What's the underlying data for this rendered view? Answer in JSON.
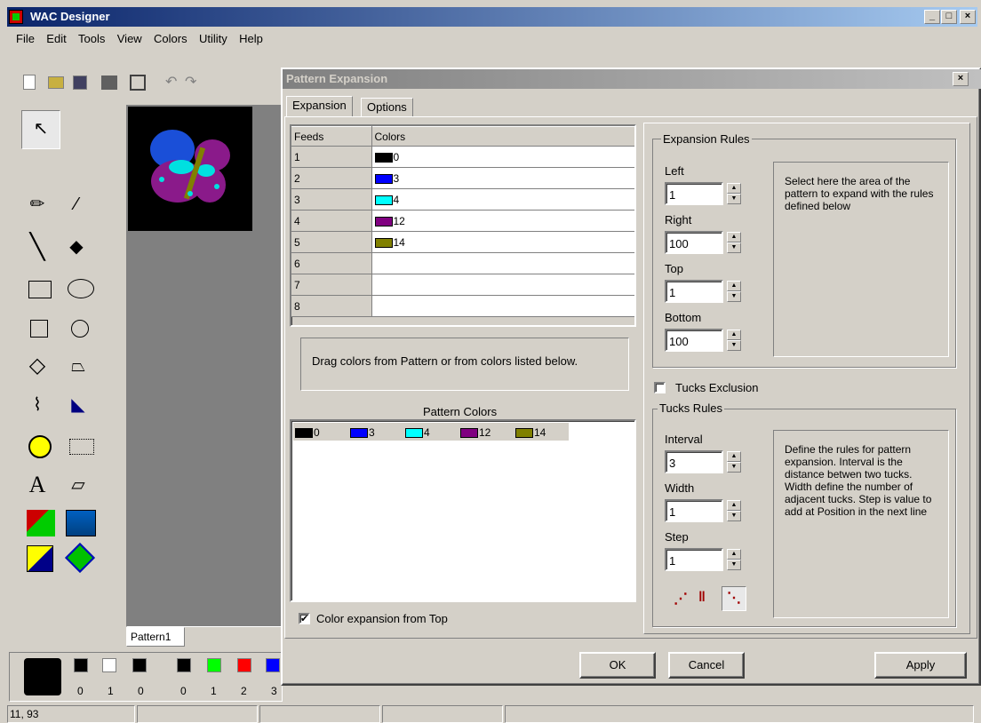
{
  "app": {
    "title": "WAC Designer",
    "btn_min": "_",
    "btn_max": "□",
    "btn_close": "×"
  },
  "menu": [
    "File",
    "Edit",
    "Tools",
    "View",
    "Colors",
    "Utility",
    "Help"
  ],
  "document_tab": "Pattern1",
  "palette_bg": {
    "labels": [
      "0",
      "1",
      "0"
    ],
    "colors": [
      "#000000",
      "#ffffff",
      "#000000"
    ]
  },
  "palette_main": {
    "labels": [
      "0",
      "1",
      "2",
      "3"
    ],
    "colors": [
      "#000000",
      "#00ff00",
      "#ff0000",
      "#0000ff"
    ]
  },
  "status": {
    "coords": "11, 93"
  },
  "dialog": {
    "title": "Pattern Expansion",
    "close": "×",
    "tabs": [
      "Expansion",
      "Options"
    ],
    "feeds_header": "Feeds",
    "colors_header": "Colors",
    "feeds": [
      {
        "feed": "1",
        "color": "#000000",
        "value": "0"
      },
      {
        "feed": "2",
        "color": "#0000ff",
        "value": "3"
      },
      {
        "feed": "3",
        "color": "#00ffff",
        "value": "4"
      },
      {
        "feed": "4",
        "color": "#800080",
        "value": "12"
      },
      {
        "feed": "5",
        "color": "#808000",
        "value": "14"
      },
      {
        "feed": "6",
        "color": "",
        "value": ""
      },
      {
        "feed": "7",
        "color": "",
        "value": ""
      },
      {
        "feed": "8",
        "color": "",
        "value": ""
      }
    ],
    "drag_hint": "Drag colors from Pattern or from colors listed below.",
    "pattern_colors_label": "Pattern Colors",
    "pattern_colors": [
      {
        "color": "#000000",
        "value": "0"
      },
      {
        "color": "#0000ff",
        "value": "3"
      },
      {
        "color": "#00ffff",
        "value": "4"
      },
      {
        "color": "#800080",
        "value": "12"
      },
      {
        "color": "#808000",
        "value": "14"
      }
    ],
    "color_expansion_label": "Color expansion from Top",
    "color_expansion_checked": "✔",
    "expansion_rules": {
      "title": "Expansion Rules",
      "left_label": "Left",
      "left": "1",
      "right_label": "Right",
      "right": "100",
      "top_label": "Top",
      "top": "1",
      "bottom_label": "Bottom",
      "bottom": "100",
      "help": "Select here the area of the pattern to expand with the rules defined below"
    },
    "tucks_exclusion": "Tucks Exclusion",
    "tucks_rules": {
      "title": "Tucks Rules",
      "interval_label": "Interval",
      "interval": "3",
      "width_label": "Width",
      "width": "1",
      "step_label": "Step",
      "step": "1",
      "help": "Define the rules for pattern expansion. Interval is the distance betwen two tucks. Width define the number of adjacent tucks. Step is value to add at Position in the next line"
    },
    "buttons": {
      "ok": "OK",
      "cancel": "Cancel",
      "apply": "Apply"
    }
  }
}
